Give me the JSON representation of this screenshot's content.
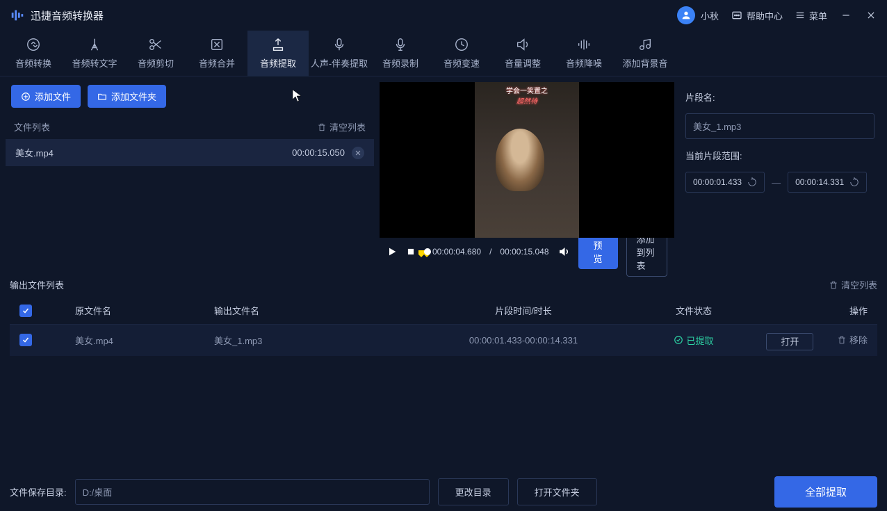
{
  "app": {
    "title": "迅捷音频转换器"
  },
  "titlebar": {
    "user": "小秋",
    "help": "帮助中心",
    "menu": "菜单"
  },
  "nav": [
    {
      "label": "音频转换"
    },
    {
      "label": "音频转文字"
    },
    {
      "label": "音频剪切"
    },
    {
      "label": "音频合并"
    },
    {
      "label": "音频提取"
    },
    {
      "label": "人声-伴奏提取"
    },
    {
      "label": "音频录制"
    },
    {
      "label": "音频变速"
    },
    {
      "label": "音量调整"
    },
    {
      "label": "音频降噪"
    },
    {
      "label": "添加背景音"
    }
  ],
  "buttons": {
    "addFile": "添加文件",
    "addFolder": "添加文件夹"
  },
  "fileList": {
    "title": "文件列表",
    "clear": "清空列表"
  },
  "files": [
    {
      "name": "美女.mp4",
      "duration": "00:00:15.050"
    }
  ],
  "overlay": {
    "line1": "学会一笑置之",
    "line2": "超然待"
  },
  "player": {
    "current": "00:00:04.680",
    "total": "00:00:15.048",
    "sep": "/"
  },
  "previewBtn": "预览",
  "addListBtn": "添加到列表",
  "segment": {
    "nameLabel": "片段名:",
    "namePlaceholder": "美女_1.mp3",
    "rangeLabel": "当前片段范围:",
    "start": "00:00:01.433",
    "end": "00:00:14.331",
    "dash": "—"
  },
  "output": {
    "title": "输出文件列表",
    "clear": "清空列表",
    "cols": {
      "src": "原文件名",
      "out": "输出文件名",
      "time": "片段时间/时长",
      "status": "文件状态",
      "action": "操作"
    },
    "rows": [
      {
        "src": "美女.mp4",
        "out": "美女_1.mp3",
        "time": "00:00:01.433-00:00:14.331",
        "status": "已提取",
        "open": "打开",
        "remove": "移除"
      }
    ]
  },
  "footer": {
    "saveLabel": "文件保存目录:",
    "path": "D:/桌面",
    "changeDir": "更改目录",
    "openFolder": "打开文件夹",
    "extractAll": "全部提取"
  }
}
